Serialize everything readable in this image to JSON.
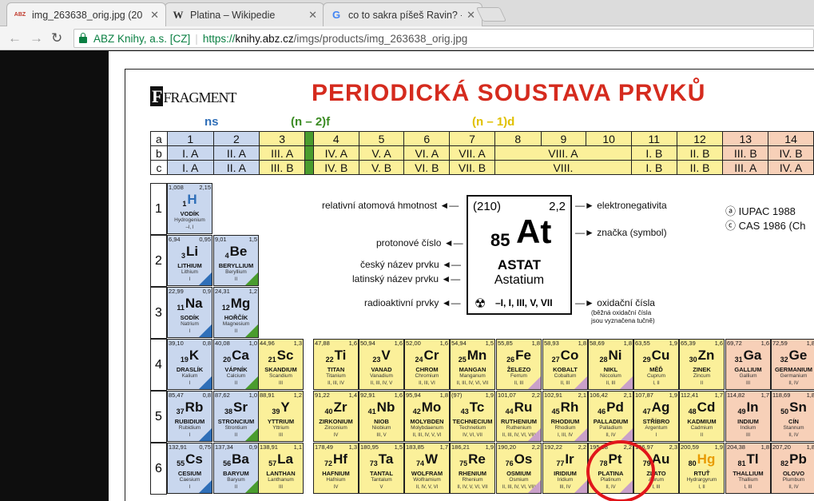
{
  "tabs": [
    {
      "title": "img_263638_orig.jpg (20",
      "favicon": "ABZ",
      "active": true
    },
    {
      "title": "Platina – Wikipedie",
      "favicon": "W",
      "active": false
    },
    {
      "title": "co to sakra píšeš Ravin? -",
      "favicon": "G",
      "active": false
    }
  ],
  "address": {
    "site_name": "ABZ Knihy, a.s. [CZ]",
    "url_prefix": "https://",
    "url_host": "knihy.abz.cz",
    "url_path": "/imgs/products/img_263638_orig.jpg"
  },
  "poster": {
    "logo": "FRAGMENT",
    "title": "PERIODICKÁ SOUSTAVA PRVKŮ",
    "labels": {
      "ns": "ns",
      "f": "(n – 2)f",
      "d": "(n – 1)d"
    },
    "group_rows": {
      "a": [
        "a",
        "1",
        "2",
        "3",
        "",
        "4",
        "5",
        "6",
        "7",
        "8",
        "9",
        "10",
        "11",
        "12",
        "13",
        "14"
      ],
      "b": [
        "b",
        "I. A",
        "II. A",
        "III. A",
        "",
        "IV. A",
        "V. A",
        "VI. A",
        "VII. A",
        "VIII. A",
        "I. B",
        "II. B",
        "III. B",
        "IV. B"
      ],
      "c": [
        "c",
        "I. A",
        "II. A",
        "III. B",
        "",
        "IV. B",
        "V. B",
        "VI. B",
        "VII. B",
        "VIII.",
        "I. B",
        "II. B",
        "III. A",
        "IV. A"
      ]
    },
    "periods": [
      "1",
      "2",
      "3",
      "4",
      "5",
      "6"
    ],
    "legend": {
      "mass": "relativní atomová hmotnost",
      "number": "protonové číslo",
      "cz_name": "český název prvku",
      "la_name": "latinský název prvku",
      "radio": "radioaktivní prvky",
      "electroneg": "elektronegativita",
      "symbol": "značka (symbol)",
      "oxid": "oxidační čísla",
      "oxid_note1": "(běžná oxidační čísla",
      "oxid_note2": "jsou vyznačena tučně)",
      "iupac": "ⓐ IUPAC 1988",
      "cas": "ⓒ CAS 1986 (Ch"
    },
    "key": {
      "mass": "(210)",
      "en": "2,2",
      "z": "85",
      "sym": "At",
      "cz": "ASTAT",
      "la": "Astatium",
      "ox": "–I, I, III, V, VII"
    },
    "elements": [
      {
        "z": "1",
        "s": "H",
        "m": "1,008",
        "e": "2,15",
        "cz": "VODÍK",
        "la": "Hydrogenium",
        "ox": "–I, I",
        "c": "blue",
        "col": 0,
        "row": 0
      },
      {
        "z": "3",
        "s": "Li",
        "m": "6,94",
        "e": "0,95",
        "cz": "LITHIUM",
        "la": "Lithium",
        "ox": "I",
        "c": "blue",
        "col": 0,
        "row": 1
      },
      {
        "z": "4",
        "s": "Be",
        "m": "9,01",
        "e": "1,5",
        "cz": "BERYLLIUM",
        "la": "Beryllium",
        "ox": "II",
        "c": "blue",
        "col": 1,
        "row": 1
      },
      {
        "z": "11",
        "s": "Na",
        "m": "22,99",
        "e": "0,9",
        "cz": "SODÍK",
        "la": "Natrium",
        "ox": "I",
        "c": "blue",
        "col": 0,
        "row": 2
      },
      {
        "z": "12",
        "s": "Mg",
        "m": "24,31",
        "e": "1,2",
        "cz": "HOŘČÍK",
        "la": "Magnesium",
        "ox": "II",
        "c": "blue",
        "col": 1,
        "row": 2
      },
      {
        "z": "19",
        "s": "K",
        "m": "39,10",
        "e": "0,8",
        "cz": "DRASLÍK",
        "la": "Kalium",
        "ox": "I",
        "c": "blue",
        "col": 0,
        "row": 3
      },
      {
        "z": "20",
        "s": "Ca",
        "m": "40,08",
        "e": "1,0",
        "cz": "VÁPNÍK",
        "la": "Calcium",
        "ox": "II",
        "c": "blue",
        "col": 1,
        "row": 3
      },
      {
        "z": "21",
        "s": "Sc",
        "m": "44,96",
        "e": "1,3",
        "cz": "SKANDIUM",
        "la": "Scandium",
        "ox": "III",
        "c": "yel",
        "col": 2,
        "row": 3
      },
      {
        "z": "22",
        "s": "Ti",
        "m": "47,88",
        "e": "1,6",
        "cz": "TITAN",
        "la": "Titanium",
        "ox": "II, III, IV",
        "c": "yel",
        "col": 3,
        "row": 3
      },
      {
        "z": "23",
        "s": "V",
        "m": "50,94",
        "e": "1,6",
        "cz": "VANAD",
        "la": "Vanadium",
        "ox": "II, III, IV, V",
        "c": "yel",
        "col": 4,
        "row": 3
      },
      {
        "z": "24",
        "s": "Cr",
        "m": "52,00",
        "e": "1,6",
        "cz": "CHROM",
        "la": "Chromium",
        "ox": "II, III, VI",
        "c": "yel",
        "col": 5,
        "row": 3
      },
      {
        "z": "25",
        "s": "Mn",
        "m": "54,94",
        "e": "1,5",
        "cz": "MANGAN",
        "la": "Manganum",
        "ox": "II, III, IV, VI, VII",
        "c": "yel",
        "col": 6,
        "row": 3
      },
      {
        "z": "26",
        "s": "Fe",
        "m": "55,85",
        "e": "1,8",
        "cz": "ŽELEZO",
        "la": "Ferrum",
        "ox": "II, III",
        "c": "yel",
        "col": 7,
        "row": 3
      },
      {
        "z": "27",
        "s": "Co",
        "m": "58,93",
        "e": "1,8",
        "cz": "KOBALT",
        "la": "Cobaltum",
        "ox": "II, III",
        "c": "yel",
        "col": 8,
        "row": 3
      },
      {
        "z": "28",
        "s": "Ni",
        "m": "58,69",
        "e": "1,8",
        "cz": "NIKL",
        "la": "Niccolum",
        "ox": "II, III",
        "c": "yel",
        "col": 9,
        "row": 3
      },
      {
        "z": "29",
        "s": "Cu",
        "m": "63,55",
        "e": "1,9",
        "cz": "MĚĎ",
        "la": "Cuprum",
        "ox": "I, II",
        "c": "yel",
        "col": 10,
        "row": 3
      },
      {
        "z": "30",
        "s": "Zn",
        "m": "65,39",
        "e": "1,6",
        "cz": "ZINEK",
        "la": "Zincum",
        "ox": "II",
        "c": "yel",
        "col": 11,
        "row": 3
      },
      {
        "z": "31",
        "s": "Ga",
        "m": "69,72",
        "e": "1,6",
        "cz": "GALLIUM",
        "la": "Gallium",
        "ox": "III",
        "c": "pink",
        "col": 12,
        "row": 3
      },
      {
        "z": "32",
        "s": "Ge",
        "m": "72,59",
        "e": "1,8",
        "cz": "GERMANIUM",
        "la": "Germanium",
        "ox": "II, IV",
        "c": "pink",
        "col": 13,
        "row": 3
      },
      {
        "z": "37",
        "s": "Rb",
        "m": "85,47",
        "e": "0,8",
        "cz": "RUBIDIUM",
        "la": "Rubidium",
        "ox": "I",
        "c": "blue",
        "col": 0,
        "row": 4
      },
      {
        "z": "38",
        "s": "Sr",
        "m": "87,62",
        "e": "1,0",
        "cz": "STRONCIUM",
        "la": "Strontium",
        "ox": "II",
        "c": "blue",
        "col": 1,
        "row": 4
      },
      {
        "z": "39",
        "s": "Y",
        "m": "88,91",
        "e": "1,2",
        "cz": "YTTRIUM",
        "la": "Yttrium",
        "ox": "III",
        "c": "yel",
        "col": 2,
        "row": 4
      },
      {
        "z": "40",
        "s": "Zr",
        "m": "91,22",
        "e": "1,4",
        "cz": "ZIRKONIUM",
        "la": "Zirconium",
        "ox": "IV",
        "c": "yel",
        "col": 3,
        "row": 4
      },
      {
        "z": "41",
        "s": "Nb",
        "m": "92,91",
        "e": "1,6",
        "cz": "NIOB",
        "la": "Niobium",
        "ox": "III, V",
        "c": "yel",
        "col": 4,
        "row": 4
      },
      {
        "z": "42",
        "s": "Mo",
        "m": "95,94",
        "e": "1,8",
        "cz": "MOLYBDEN",
        "la": "Molybdaenum",
        "ox": "II, III, IV, V, VI",
        "c": "yel",
        "col": 5,
        "row": 4
      },
      {
        "z": "43",
        "s": "Tc",
        "m": "(97)",
        "e": "1,9",
        "cz": "TECHNECIUM",
        "la": "Technetium",
        "ox": "IV, VI, VII",
        "c": "yel",
        "col": 6,
        "row": 4
      },
      {
        "z": "44",
        "s": "Ru",
        "m": "101,07",
        "e": "2,2",
        "cz": "RUTHENIUM",
        "la": "Ruthenium",
        "ox": "II, III, IV, VI, VIII",
        "c": "yel",
        "col": 7,
        "row": 4
      },
      {
        "z": "45",
        "s": "Rh",
        "m": "102,91",
        "e": "2,1",
        "cz": "RHODIUM",
        "la": "Rhodium",
        "ox": "I, III, IV",
        "c": "yel",
        "col": 8,
        "row": 4
      },
      {
        "z": "46",
        "s": "Pd",
        "m": "106,42",
        "e": "2,1",
        "cz": "PALLADIUM",
        "la": "Palladium",
        "ox": "II, IV",
        "c": "yel",
        "col": 9,
        "row": 4
      },
      {
        "z": "47",
        "s": "Ag",
        "m": "107,87",
        "e": "1,9",
        "cz": "STŘÍBRO",
        "la": "Argentum",
        "ox": "I",
        "c": "yel",
        "col": 10,
        "row": 4
      },
      {
        "z": "48",
        "s": "Cd",
        "m": "112,41",
        "e": "1,7",
        "cz": "KADMIUM",
        "la": "Cadmium",
        "ox": "II",
        "c": "yel",
        "col": 11,
        "row": 4
      },
      {
        "z": "49",
        "s": "In",
        "m": "114,82",
        "e": "1,7",
        "cz": "INDIUM",
        "la": "Indium",
        "ox": "III",
        "c": "pink",
        "col": 12,
        "row": 4
      },
      {
        "z": "50",
        "s": "Sn",
        "m": "118,69",
        "e": "1,8",
        "cz": "CÍN",
        "la": "Stannum",
        "ox": "II, IV",
        "c": "pink",
        "col": 13,
        "row": 4
      },
      {
        "z": "55",
        "s": "Cs",
        "m": "132,91",
        "e": "0,75",
        "cz": "CESIUM",
        "la": "Caesium",
        "ox": "I",
        "c": "blue",
        "col": 0,
        "row": 5
      },
      {
        "z": "56",
        "s": "Ba",
        "m": "137,34",
        "e": "0,9",
        "cz": "BARYUM",
        "la": "Baryum",
        "ox": "II",
        "c": "blue",
        "col": 1,
        "row": 5
      },
      {
        "z": "57",
        "s": "La",
        "m": "138,91",
        "e": "1,1",
        "cz": "LANTHAN",
        "la": "Lanthanum",
        "ox": "III",
        "c": "yel",
        "col": 2,
        "row": 5
      },
      {
        "z": "72",
        "s": "Hf",
        "m": "178,49",
        "e": "1,3",
        "cz": "HAFNIUM",
        "la": "Hafnium",
        "ox": "IV",
        "c": "yel",
        "col": 3,
        "row": 5
      },
      {
        "z": "73",
        "s": "Ta",
        "m": "180,95",
        "e": "1,5",
        "cz": "TANTAL",
        "la": "Tantalum",
        "ox": "V",
        "c": "yel",
        "col": 4,
        "row": 5
      },
      {
        "z": "74",
        "s": "W",
        "m": "183,85",
        "e": "1,7",
        "cz": "WOLFRAM",
        "la": "Wolframium",
        "ox": "II, IV, V, VI",
        "c": "yel",
        "col": 5,
        "row": 5
      },
      {
        "z": "75",
        "s": "Re",
        "m": "186,21",
        "e": "1,9",
        "cz": "RHENIUM",
        "la": "Rhenium",
        "ox": "II, IV, V, VI, VII",
        "c": "yel",
        "col": 6,
        "row": 5
      },
      {
        "z": "76",
        "s": "Os",
        "m": "190,20",
        "e": "2,2",
        "cz": "OSMIUM",
        "la": "Osmium",
        "ox": "II, III, IV, VI, VIII",
        "c": "yel",
        "col": 7,
        "row": 5
      },
      {
        "z": "77",
        "s": "Ir",
        "m": "192,22",
        "e": "2,2",
        "cz": "IRIDIUM",
        "la": "Iridium",
        "ox": "III, IV",
        "c": "yel",
        "col": 8,
        "row": 5
      },
      {
        "z": "78",
        "s": "Pt",
        "m": "195,08",
        "e": "2,2",
        "cz": "PLATINA",
        "la": "Platinum",
        "ox": "II, IV",
        "c": "yel",
        "col": 9,
        "row": 5
      },
      {
        "z": "79",
        "s": "Au",
        "m": "196,97",
        "e": "2,3",
        "cz": "ZLATO",
        "la": "Aurum",
        "ox": "I, III",
        "c": "yel",
        "col": 10,
        "row": 5
      },
      {
        "z": "80",
        "s": "Hg",
        "m": "200,59",
        "e": "1,9",
        "cz": "RTUŤ",
        "la": "Hydrargyrum",
        "ox": "I, II",
        "c": "yel",
        "col": 11,
        "row": 5
      },
      {
        "z": "81",
        "s": "Tl",
        "m": "204,38",
        "e": "1,8",
        "cz": "THALLIUM",
        "la": "Thallium",
        "ox": "I, III",
        "c": "pink",
        "col": 12,
        "row": 5
      },
      {
        "z": "82",
        "s": "Pb",
        "m": "207,20",
        "e": "1,8",
        "cz": "OLOVO",
        "la": "Plumbum",
        "ox": "II, IV",
        "c": "pink",
        "col": 13,
        "row": 5
      }
    ]
  }
}
